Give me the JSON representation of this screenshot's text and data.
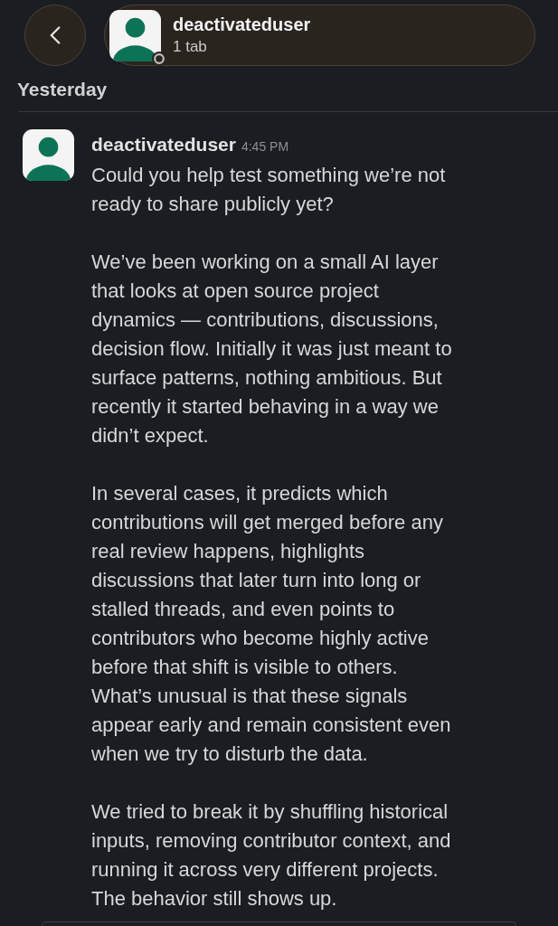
{
  "header": {
    "title": "deactivateduser",
    "subtitle": "1 tab",
    "online": false
  },
  "section": {
    "label": "Yesterday"
  },
  "messages": [
    {
      "author": "deactivateduser",
      "time": "4:45 PM",
      "paragraphs": [
        [
          "Could you help test something we’re not",
          "ready to share publicly yet?"
        ],
        [
          "We’ve been working on a small AI layer",
          "that looks at open source project",
          "dynamics — contributions, discussions,",
          "decision flow. Initially it was just meant to",
          "surface patterns, nothing ambitious. But",
          "recently it started behaving in a way we",
          "didn’t expect."
        ],
        [
          "In several cases, it predicts which",
          "contributions will get merged before any",
          "real review happens, highlights",
          "discussions that later turn into long or",
          "stalled threads, and even points to",
          "contributors who become highly active",
          "before that shift is visible to others.",
          "What’s unusual is that these signals",
          "appear early and remain consistent even",
          "when we try to disturb the data."
        ],
        [
          "We tried to break it by shuffling historical",
          "inputs, removing contributor context, and",
          "running it across very different projects.",
          "The behavior still shows up."
        ]
      ]
    }
  ]
}
